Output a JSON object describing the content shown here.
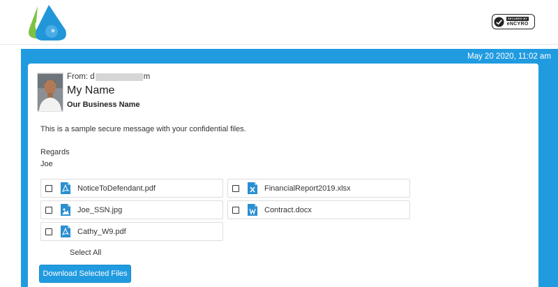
{
  "header": {
    "logo_icon": "water-drop-logo-icon",
    "badge": {
      "line1": "SECURED BY",
      "line2": "eNCYRO",
      "icon": "check-circle-icon"
    }
  },
  "message": {
    "timestamp": "May 20 2020, 11:02 am",
    "from_label": "From:",
    "from_prefix": "d",
    "from_suffix": "m",
    "sender_name": "My Name",
    "business_name": "Our Business Name",
    "body": "This is a sample secure message with your confidential files.",
    "regards": "Regards",
    "signature": "Joe"
  },
  "attachments": [
    {
      "name": "NoticeToDefendant.pdf",
      "icon": "pdf-file-icon",
      "checked": false
    },
    {
      "name": "FinancialReport2019.xlsx",
      "icon": "excel-file-icon",
      "checked": false
    },
    {
      "name": "Joe_SSN.jpg",
      "icon": "image-file-icon",
      "checked": false
    },
    {
      "name": "Contract.docx",
      "icon": "word-file-icon",
      "checked": false
    },
    {
      "name": "Cathy_W9.pdf",
      "icon": "pdf-file-icon",
      "checked": false
    }
  ],
  "actions": {
    "select_all_label": "Select All",
    "download_label": "Download Selected Files"
  },
  "colors": {
    "accent": "#219be0",
    "logo_green": "#7dc242"
  }
}
